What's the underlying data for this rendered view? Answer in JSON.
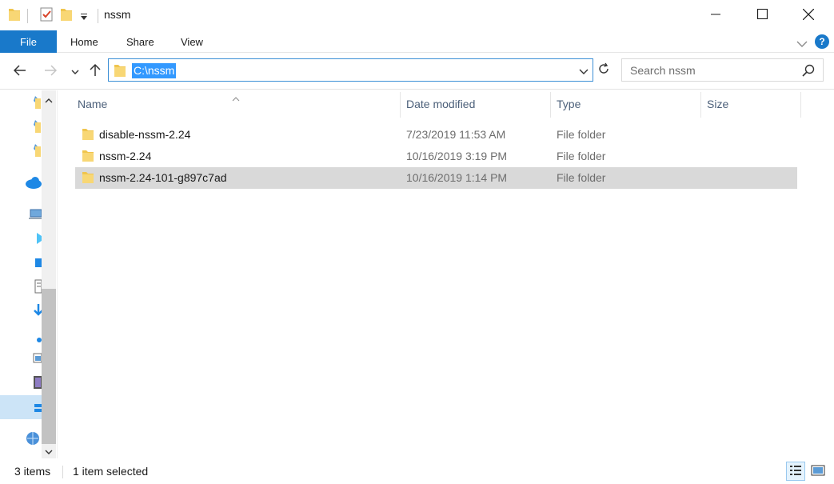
{
  "window": {
    "title": "nssm",
    "minimize_icon": "minimize-icon",
    "maximize_icon": "maximize-icon",
    "close_icon": "close-icon"
  },
  "ribbon": {
    "tabs": [
      {
        "label": "File",
        "active": true
      },
      {
        "label": "Home"
      },
      {
        "label": "Share"
      },
      {
        "label": "View"
      }
    ],
    "help_label": "?"
  },
  "address": {
    "path": "C:\\nssm",
    "search_placeholder": "Search nssm"
  },
  "columns": [
    "Name",
    "Date modified",
    "Type",
    "Size"
  ],
  "files": [
    {
      "name": "disable-nssm-2.24",
      "date": "7/23/2019 11:53 AM",
      "type": "File folder",
      "size": "",
      "selected": false
    },
    {
      "name": "nssm-2.24",
      "date": "10/16/2019 3:19 PM",
      "type": "File folder",
      "size": "",
      "selected": false
    },
    {
      "name": "nssm-2.24-101-g897c7ad",
      "date": "10/16/2019 1:14 PM",
      "type": "File folder",
      "size": "",
      "selected": true
    }
  ],
  "status": {
    "item_count": "3 items",
    "selection": "1 item selected"
  },
  "colors": {
    "accent": "#1979ca",
    "selection_highlight": "#3399ff",
    "selected_row": "#d9d9d9",
    "folder": "#f8d775"
  }
}
